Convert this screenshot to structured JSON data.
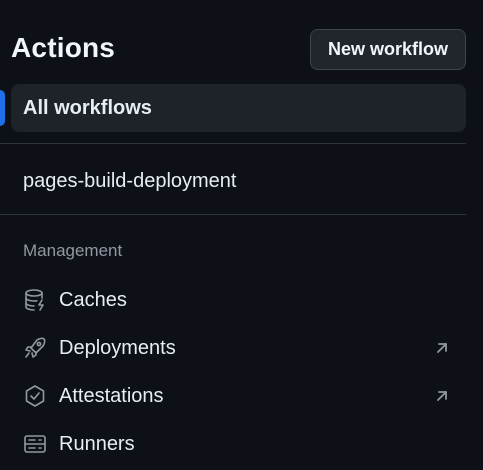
{
  "header": {
    "title": "Actions",
    "new_workflow_label": "New workflow"
  },
  "workflows": {
    "all_label": "All workflows",
    "items": [
      {
        "label": "pages-build-deployment"
      }
    ]
  },
  "management": {
    "heading": "Management",
    "items": [
      {
        "label": "Caches",
        "icon": "database-icon",
        "external": false
      },
      {
        "label": "Deployments",
        "icon": "rocket-icon",
        "external": true
      },
      {
        "label": "Attestations",
        "icon": "shield-check-icon",
        "external": true
      },
      {
        "label": "Runners",
        "icon": "server-icon",
        "external": false
      }
    ]
  },
  "colors": {
    "background": "#0d1117",
    "accent": "#1f6feb",
    "muted_text": "#9198a1",
    "active_bg": "#1e232a"
  }
}
